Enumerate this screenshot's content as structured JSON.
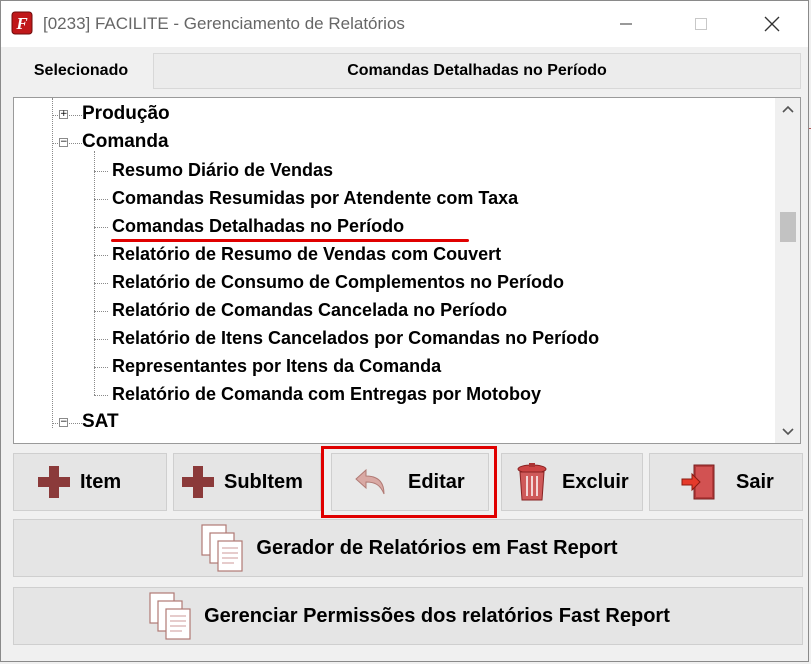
{
  "window": {
    "title": "[0233] FACILITE - Gerenciamento de Relatórios"
  },
  "selected": {
    "label": "Selecionado",
    "value": "Comandas Detalhadas no Período"
  },
  "tree": {
    "nodes": [
      {
        "label": "Produção",
        "expanded": false
      },
      {
        "label": "Comanda",
        "expanded": true
      },
      {
        "label": "SAT",
        "expanded": true
      }
    ],
    "comanda_children": [
      "Resumo Diário de Vendas",
      "Comandas Resumidas por Atendente com Taxa",
      "Comandas Detalhadas no Período",
      "Relatório de Resumo de Vendas com Couvert",
      "Relatório de Consumo de Complementos no Período",
      "Relatório de Comandas Cancelada no Período",
      "Relatório de Itens Cancelados por Comandas no Período",
      "Representantes por Itens da Comanda",
      "Relatório de Comanda com Entregas por Motoboy"
    ]
  },
  "buttons": {
    "item": "Item",
    "subitem": "SubItem",
    "editar": "Editar",
    "excluir": "Excluir",
    "sair": "Sair",
    "gerador": "Gerador de Relatórios em Fast Report",
    "permissoes": "Gerenciar Permissões dos relatórios Fast Report"
  },
  "colors": {
    "highlight": "#e00000",
    "plus_icon": "#8b3a3a",
    "button_bg": "#e5e5e5"
  }
}
